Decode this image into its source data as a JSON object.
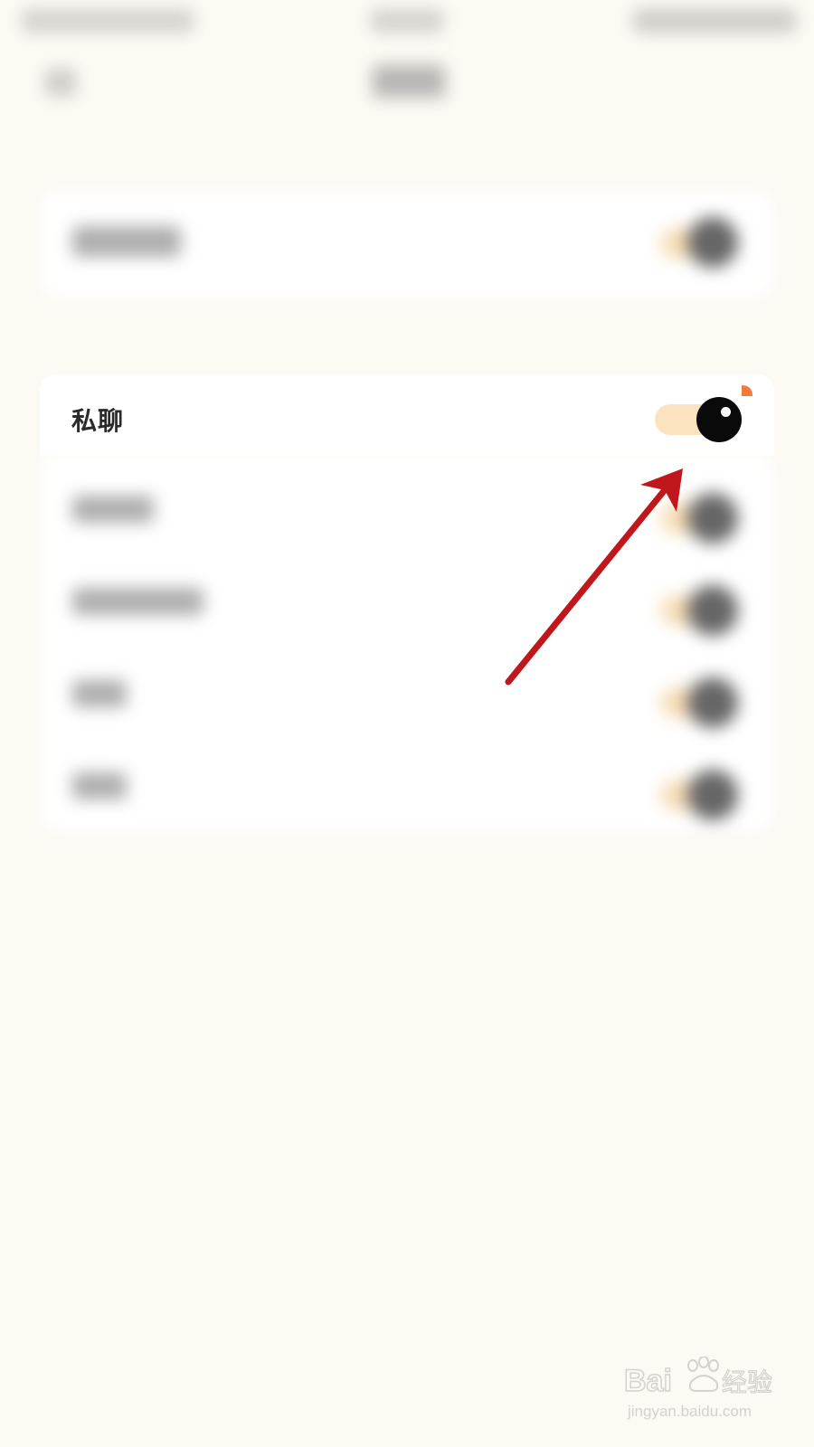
{
  "row": {
    "label": "私聊",
    "toggle_on": true
  },
  "colors": {
    "background": "#fdf9f3",
    "card": "#ffffff",
    "toggle_track": "#fbe3c0",
    "toggle_knob": "#0a0a0a",
    "toggle_accent": "#f27a3f",
    "annotation": "#c0171c"
  },
  "watermark": {
    "brand": "Baidu经验",
    "url": "jingyan.baidu.com"
  }
}
